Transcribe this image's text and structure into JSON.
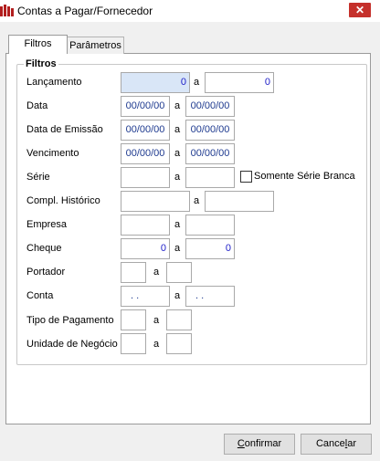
{
  "window": {
    "title": "Contas a Pagar/Fornecedor",
    "close_glyph": "✕"
  },
  "tabs": [
    {
      "label": "Filtros",
      "active": true
    },
    {
      "label": "Parâmetros",
      "active": false
    }
  ],
  "group": {
    "title": "Filtros"
  },
  "separator": "a",
  "fields": {
    "lancamento": {
      "label": "Lançamento",
      "from": "0",
      "to": "0"
    },
    "data": {
      "label": "Data",
      "from": "00/00/00",
      "to": "00/00/00"
    },
    "data_emissao": {
      "label": "Data de Emissão",
      "from": "00/00/00",
      "to": "00/00/00"
    },
    "vencimento": {
      "label": "Vencimento",
      "from": "00/00/00",
      "to": "00/00/00"
    },
    "serie": {
      "label": "Série",
      "from": "",
      "to": ""
    },
    "somente_serie_branca": {
      "label": "Somente Série Branca",
      "checked": false
    },
    "compl_historico": {
      "label": "Compl. Histórico",
      "from": "",
      "to": ""
    },
    "empresa": {
      "label": "Empresa",
      "from": "",
      "to": ""
    },
    "cheque": {
      "label": "Cheque",
      "from": "0",
      "to": "0"
    },
    "portador": {
      "label": "Portador",
      "from": "",
      "to": ""
    },
    "conta": {
      "label": "Conta",
      "from": ". .",
      "to": ". ."
    },
    "tipo_pagamento": {
      "label": "Tipo de Pagamento",
      "from": "",
      "to": ""
    },
    "unidade_negocio": {
      "label": "Unidade de Negócio",
      "from": "",
      "to": ""
    }
  },
  "buttons": {
    "confirmar": {
      "mnemonic": "C",
      "rest": "onfirmar"
    },
    "cancelar": {
      "pre": "Cance",
      "mnemonic": "l",
      "rest": "ar"
    }
  },
  "colors": {
    "close": "#c5302b",
    "value_text": "#1e3a8f",
    "focused_bg": "#d9e6f7"
  },
  "icons": {
    "app": "app-logo-icon",
    "close": "close-icon",
    "checkbox": "checkbox-icon"
  }
}
